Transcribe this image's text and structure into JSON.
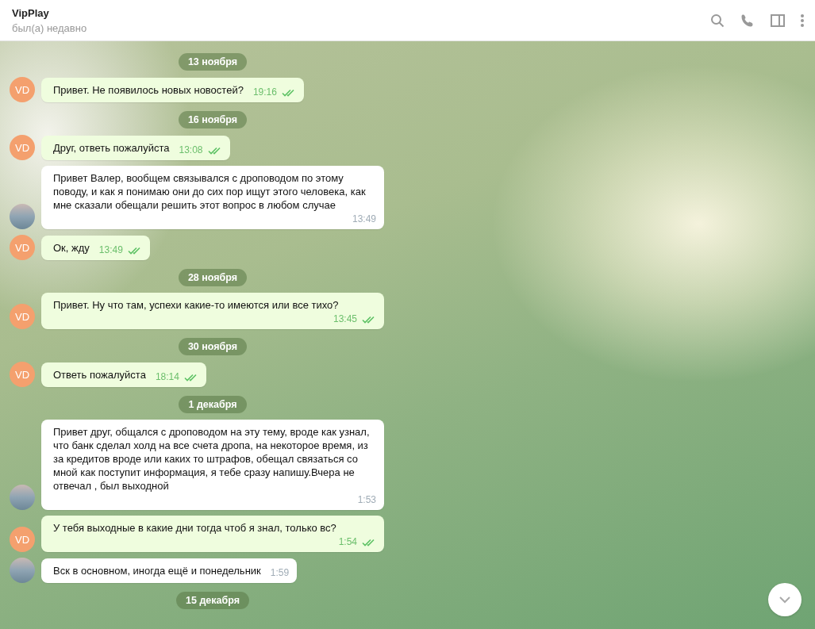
{
  "header": {
    "title": "VipPlay",
    "status": "был(а) недавно"
  },
  "messages": [
    {
      "kind": "date",
      "text": "13 ноября"
    },
    {
      "kind": "message",
      "outgoing": true,
      "avatar": "VD",
      "text": "Привет. Не появилось новых новостей?",
      "time": "19:16",
      "read": true
    },
    {
      "kind": "date",
      "text": "16 ноября"
    },
    {
      "kind": "message",
      "outgoing": true,
      "avatar": "VD",
      "text": "Друг, ответь пожалуйста",
      "time": "13:08",
      "read": true
    },
    {
      "kind": "message",
      "outgoing": false,
      "text": "Привет Валер, вообщем связывался с дроповодом по этому поводу, и как я понимаю  они до сих пор  ищут этого человека, как мне сказали  обещали решить этот вопрос  в любом случае",
      "time": "13:49"
    },
    {
      "kind": "message",
      "outgoing": true,
      "avatar": "VD",
      "text": "Ок, жду",
      "time": "13:49",
      "read": true
    },
    {
      "kind": "date",
      "text": "28 ноября"
    },
    {
      "kind": "message",
      "outgoing": true,
      "avatar": "VD",
      "text": "Привет. Ну что там, успехи какие-то имеются или все тихо?",
      "time": "13:45",
      "read": true
    },
    {
      "kind": "date",
      "text": "30 ноября"
    },
    {
      "kind": "message",
      "outgoing": true,
      "avatar": "VD",
      "text": "Ответь пожалуйста",
      "time": "18:14",
      "read": true
    },
    {
      "kind": "date",
      "text": "1 декабря"
    },
    {
      "kind": "message",
      "outgoing": false,
      "text": "Привет друг, общался с дроповодом  на эту тему, вроде как узнал, что банк сделал холд на все счета дропа, на некоторое время, из за кредитов вроде или каких то штрафов, обещал связаться со мной  как поступит информация,  я тебе сразу напишу.Вчера не отвечал , был выходной",
      "time": "1:53"
    },
    {
      "kind": "message",
      "outgoing": true,
      "avatar": "VD",
      "text": "У тебя выходные в какие дни тогда чтоб я знал, только вс?",
      "time": "1:54",
      "read": true
    },
    {
      "kind": "message",
      "outgoing": false,
      "text": "Вск в основном,  иногда  ещё  и понедельник",
      "time": "1:59"
    },
    {
      "kind": "date",
      "text": "15 декабря"
    }
  ]
}
